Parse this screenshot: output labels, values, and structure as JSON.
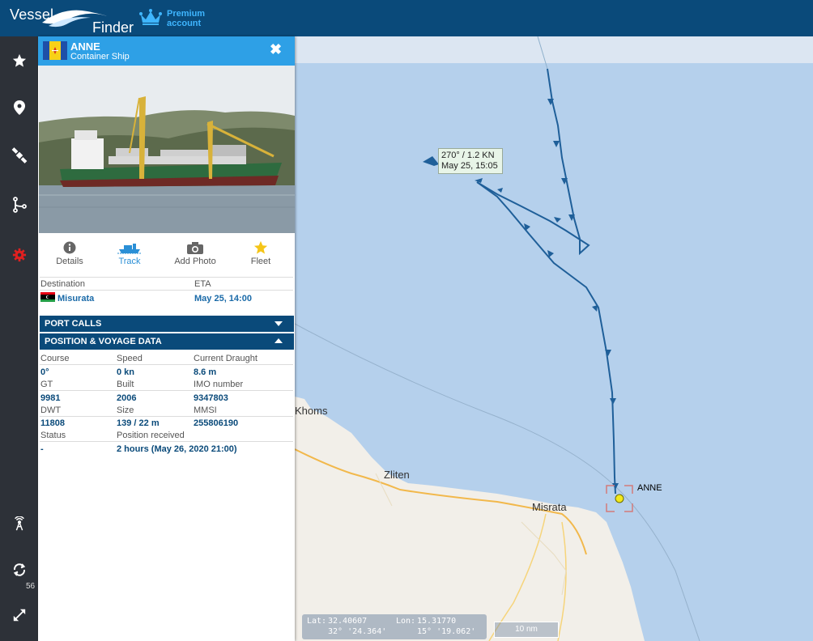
{
  "app": {
    "logo_line1": "Vessel",
    "logo_line2": "Finder",
    "premium_line1": "Premium",
    "premium_line2": "account"
  },
  "sidebar": {
    "items": [
      {
        "icon": "star-icon"
      },
      {
        "icon": "map-pin-icon"
      },
      {
        "icon": "satellite-icon"
      },
      {
        "icon": "route-icon"
      },
      {
        "icon": "gear-icon"
      },
      {
        "icon": "antenna-icon"
      },
      {
        "icon": "refresh-icon"
      },
      {
        "icon": "fullscreen-icon"
      }
    ],
    "refresh_count": "56"
  },
  "vessel": {
    "name": "ANNE",
    "type": "Container Ship",
    "close": "✖"
  },
  "tabs": [
    {
      "label": "Details",
      "icon": "info-icon"
    },
    {
      "label": "Track",
      "icon": "ship-icon"
    },
    {
      "label": "Add Photo",
      "icon": "camera-icon"
    },
    {
      "label": "Fleet",
      "icon": "star-icon"
    }
  ],
  "destination": {
    "dest_label": "Destination",
    "dest_value": "Misurata",
    "eta_label": "ETA",
    "eta_value": "May 25, 14:00"
  },
  "sections": {
    "port_calls": "PORT CALLS",
    "position": "POSITION & VOYAGE DATA"
  },
  "voyage": {
    "course_label": "Course",
    "course": "0°",
    "speed_label": "Speed",
    "speed": "0 kn",
    "draught_label": "Current Draught",
    "draught": "8.6 m",
    "gt_label": "GT",
    "gt": "9981",
    "built_label": "Built",
    "built": "2006",
    "imo_label": "IMO number",
    "imo": "9347803",
    "dwt_label": "DWT",
    "dwt": "11808",
    "size_label": "Size",
    "size": "139 / 22 m",
    "mmsi_label": "MMSI",
    "mmsi": "255806190",
    "status_label": "Status",
    "status": "-",
    "posrec_label": "Position received",
    "posrec": "2 hours (May 26, 2020 21:00)"
  },
  "map": {
    "labels": {
      "khoms": "Khoms",
      "zliten": "Zliten",
      "misrata": "Misrata"
    },
    "info_line1": "270° / 1.2 KN",
    "info_line2": "May 25,  15:05",
    "ship_label": "ANNE",
    "lat_label": "Lat:",
    "lat": "32.40607",
    "lon_label": "Lon:",
    "lon": "15.31770",
    "lat_dms": "32° '24.364'",
    "lon_dms": "15° '19.062'",
    "scale": "10 nm"
  }
}
